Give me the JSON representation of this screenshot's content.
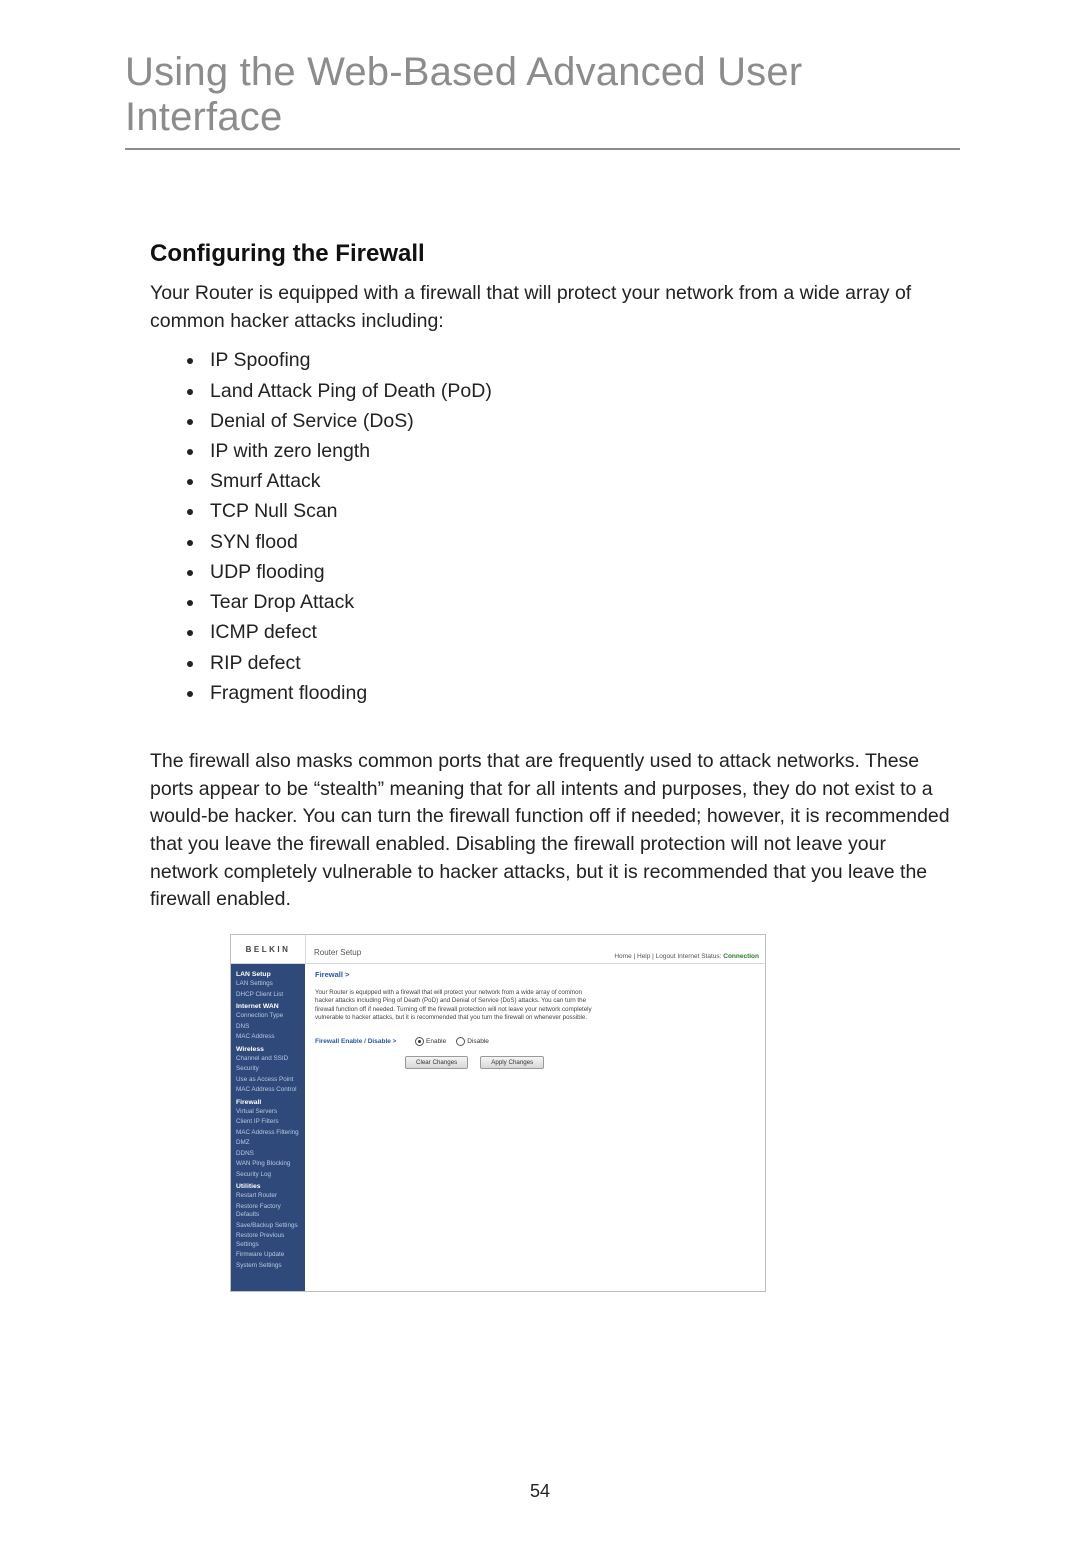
{
  "page": {
    "title": "Using the Web-Based Advanced User Interface",
    "number": "54"
  },
  "section": {
    "heading": "Configuring the Firewall",
    "intro": "Your Router is equipped with a firewall that will protect your network from a wide array of common hacker attacks including:",
    "attacks": [
      "IP Spoofing",
      "Land Attack Ping of Death (PoD)",
      "Denial of Service (DoS)",
      "IP with zero length",
      "Smurf Attack",
      "TCP Null Scan",
      "SYN flood",
      "UDP flooding",
      "Tear Drop Attack",
      "ICMP defect",
      "RIP defect",
      "Fragment flooding"
    ],
    "body": "The firewall also masks common ports that are frequently used to attack networks. These ports appear to be “stealth” meaning that for all intents and purposes, they do not exist to a would-be hacker. You can turn the firewall function off if needed; however, it is recommended that you leave the firewall enabled. Disabling the firewall protection will not leave your network completely vulnerable to hacker attacks, but it is recommended that you leave the firewall enabled."
  },
  "router": {
    "logo": "BELKIN",
    "header_title": "Router Setup",
    "toplinks_prefix": "Home | Help | Logout   Internet Status: ",
    "toplinks_status": "Connection",
    "breadcrumb": "Firewall >",
    "desc": "Your Router is equipped with a firewall that will protect your network from a wide array of common hacker attacks including Ping of Death (PoD) and Denial of Service (DoS) attacks. You can turn the firewall function off if needed. Turning off the firewall protection will not leave your network completely vulnerable to hacker attacks, but it is recommended that you turn the firewall on whenever possible.",
    "row_label": "Firewall Enable / Disable >",
    "radio_enable": "Enable",
    "radio_disable": "Disable",
    "btn_clear": "Clear Changes",
    "btn_apply": "Apply Changes",
    "sidebar": [
      {
        "type": "grp",
        "label": "LAN Setup"
      },
      {
        "type": "itm",
        "label": "LAN Settings"
      },
      {
        "type": "itm",
        "label": "DHCP Client List"
      },
      {
        "type": "grp",
        "label": "Internet WAN"
      },
      {
        "type": "itm",
        "label": "Connection Type"
      },
      {
        "type": "itm",
        "label": "DNS"
      },
      {
        "type": "itm",
        "label": "MAC Address"
      },
      {
        "type": "grp",
        "label": "Wireless"
      },
      {
        "type": "itm",
        "label": "Channel and SSID"
      },
      {
        "type": "itm",
        "label": "Security"
      },
      {
        "type": "itm",
        "label": "Use as Access Point"
      },
      {
        "type": "itm",
        "label": "MAC Address Control"
      },
      {
        "type": "grp",
        "label": "Firewall",
        "active": true
      },
      {
        "type": "itm",
        "label": "Virtual Servers"
      },
      {
        "type": "itm",
        "label": "Client IP Filters"
      },
      {
        "type": "itm",
        "label": "MAC Address Filtering"
      },
      {
        "type": "itm",
        "label": "DMZ"
      },
      {
        "type": "itm",
        "label": "DDNS"
      },
      {
        "type": "itm",
        "label": "WAN Ping Blocking"
      },
      {
        "type": "itm",
        "label": "Security Log"
      },
      {
        "type": "grp",
        "label": "Utilities"
      },
      {
        "type": "itm",
        "label": "Restart Router"
      },
      {
        "type": "itm",
        "label": "Restore Factory Defaults"
      },
      {
        "type": "itm",
        "label": "Save/Backup Settings"
      },
      {
        "type": "itm",
        "label": "Restore Previous Settings"
      },
      {
        "type": "itm",
        "label": "Firmware Update"
      },
      {
        "type": "itm",
        "label": "System Settings"
      }
    ]
  }
}
